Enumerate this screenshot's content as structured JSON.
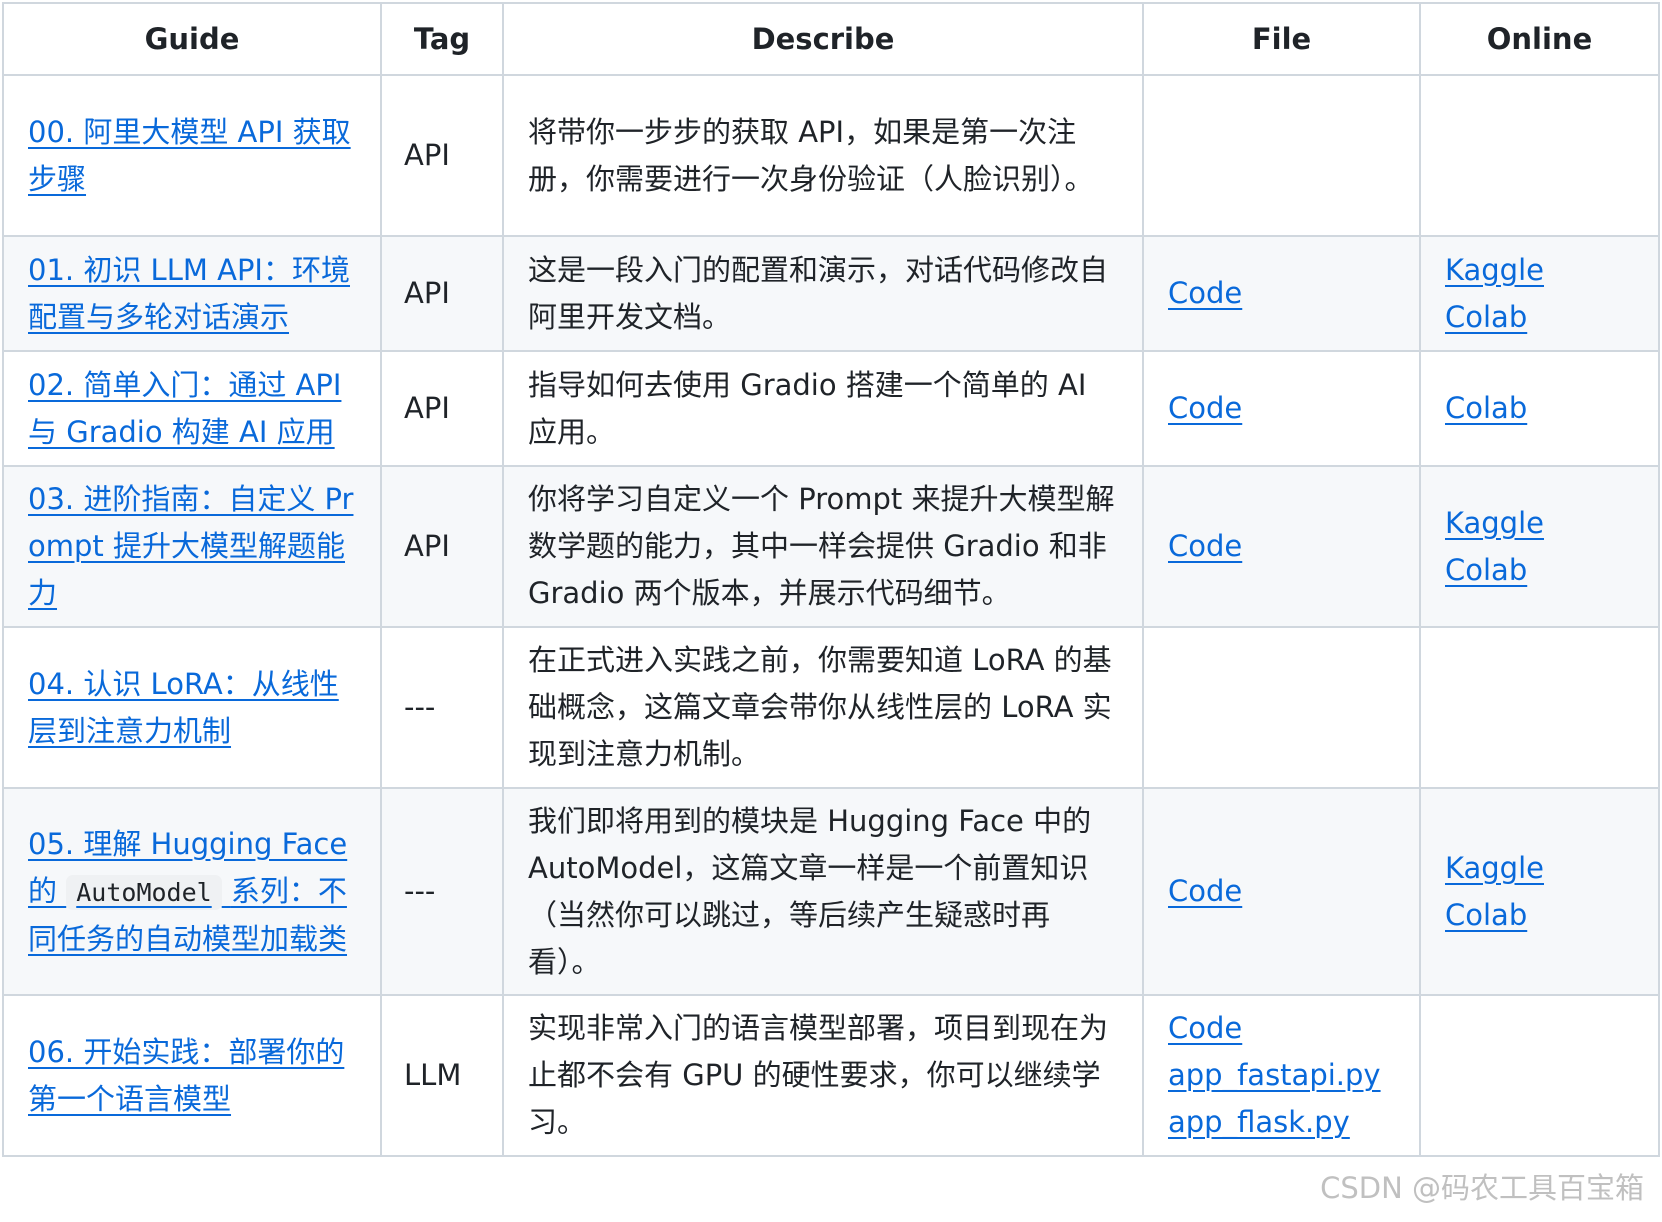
{
  "table": {
    "headers": [
      "Guide",
      "Tag",
      "Describe",
      "File",
      "Online"
    ],
    "rows": [
      {
        "guide": "00. 阿里大模型 API 获取步骤",
        "tag": "API",
        "describe": "将带你一步步的获取 API，如果是第一次注册，你需要进行一次身份验证（人脸识别）。",
        "files": [],
        "online": []
      },
      {
        "guide": "01. 初识 LLM API：环境配置与多轮对话演示",
        "tag": "API",
        "describe": "这是一段入门的配置和演示，对话代码修改自阿里开发文档。",
        "files": [
          "Code"
        ],
        "online": [
          "Kaggle",
          "Colab"
        ]
      },
      {
        "guide": "02. 简单入门：通过 API 与 Gradio 构建 AI 应用",
        "tag": "API",
        "describe": "指导如何去使用 Gradio 搭建一个简单的 AI 应用。",
        "files": [
          "Code"
        ],
        "online": [
          "Colab"
        ]
      },
      {
        "guide": "03. 进阶指南：自定义 Prompt 提升大模型解题能力",
        "tag": "API",
        "describe": "你将学习自定义一个 Prompt 来提升大模型解数学题的能力，其中一样会提供 Gradio 和非 Gradio 两个版本，并展示代码细节。",
        "files": [
          "Code"
        ],
        "online": [
          "Kaggle",
          "Colab"
        ]
      },
      {
        "guide": "04. 认识 LoRA：从线性层到注意力机制",
        "tag": "---",
        "describe": "在正式进入实践之前，你需要知道 LoRA 的基础概念，这篇文章会带你从线性层的 LoRA 实现到注意力机制。",
        "files": [],
        "online": []
      },
      {
        "guide_before": "05. 理解 Hugging Face 的",
        "guide_code": "AutoModel",
        "guide_after": "系列：不同任务的自动模型加载类",
        "tag": "---",
        "describe": "我们即将用到的模块是 Hugging Face 中的 AutoModel，这篇文章一样是一个前置知识（当然你可以跳过，等后续产生疑惑时再看）。",
        "files": [
          "Code"
        ],
        "online": [
          "Kaggle",
          "Colab"
        ]
      },
      {
        "guide": "06. 开始实践：部署你的第一个语言模型",
        "tag": "LLM",
        "describe": "实现非常入门的语言模型部署，项目到现在为止都不会有 GPU 的硬性要求，你可以继续学习。",
        "files": [
          "Code",
          "app_fastapi.py",
          "app_flask.py"
        ],
        "online": []
      }
    ]
  },
  "watermark": "CSDN @码农工具百宝箱",
  "colors": {
    "link": "#0969da",
    "border": "#d0d7de",
    "stripe": "#f6f8fa",
    "text": "#1f2328"
  }
}
